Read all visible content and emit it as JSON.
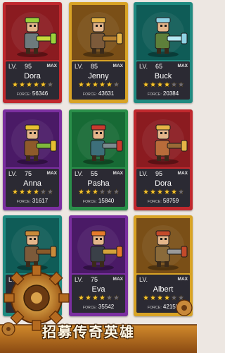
{
  "banner": {
    "title": "招募传奇英雄"
  },
  "cards": [
    {
      "level": "95",
      "name": "Dora",
      "stars": 5,
      "force": "56346",
      "border": "#c0282d",
      "bg": "#8b1b20",
      "hero": "#6d7a7c",
      "accent": "#9ad13a",
      "weapon": "#c5d83a"
    },
    {
      "level": "85",
      "name": "Jenny",
      "stars": 5,
      "force": "43631",
      "border": "#d8a325",
      "bg": "#7a4f17",
      "hero": "#7c5a3a",
      "accent": "#e6b446",
      "weapon": "#b7802f"
    },
    {
      "level": "65",
      "name": "Buck",
      "stars": 4,
      "force": "20384",
      "border": "#1f8a80",
      "bg": "#0f5c57",
      "hero": "#5e7f3a",
      "accent": "#8ed2e4",
      "weapon": "#b5e8f2"
    },
    {
      "level": "75",
      "name": "Anna",
      "stars": 4,
      "force": "31617",
      "border": "#7b2fa0",
      "bg": "#4a1a66",
      "hero": "#8e5a2a",
      "accent": "#e6c030",
      "weapon": "#7fb83c"
    },
    {
      "level": "55",
      "name": "Pasha",
      "stars": 3,
      "force": "15840",
      "border": "#2a8f4a",
      "bg": "#176a35",
      "hero": "#3d6f7a",
      "accent": "#c93a2e",
      "weapon": "#7b8b8e"
    },
    {
      "level": "95",
      "name": "Dora",
      "stars": 5,
      "force": "58759",
      "border": "#c0282d",
      "bg": "#8b1b20",
      "hero": "#b86c3a",
      "accent": "#e6b446",
      "weapon": "#9a6a36"
    },
    {
      "level": "65",
      "name": "",
      "stars": 4,
      "force": "",
      "border": "#1f8a80",
      "bg": "#0f5c57",
      "hero": "#7c5a3a",
      "accent": "#c98a3a",
      "weapon": "#8a5a2a"
    },
    {
      "level": "75",
      "name": "Eva",
      "stars": 4,
      "force": "35542",
      "border": "#7b2fa0",
      "bg": "#4a1a66",
      "hero": "#3a4048",
      "accent": "#e67a2a",
      "weapon": "#d4a23a"
    },
    {
      "level": "",
      "name": "Albert",
      "stars": 4,
      "force": "42155",
      "border": "#d8a325",
      "bg": "#7a4f17",
      "hero": "#8a6a3a",
      "accent": "#c44a2a",
      "weapon": "#9a9a9a"
    }
  ],
  "labels": {
    "lv": "LV.",
    "max": "MAX",
    "force": "FORCE:"
  },
  "colors": {
    "star_on": "#f2c12e",
    "star_off": "#6d6b73",
    "info_bg": "#2b2a33",
    "page_bg": "#ede7e2"
  }
}
